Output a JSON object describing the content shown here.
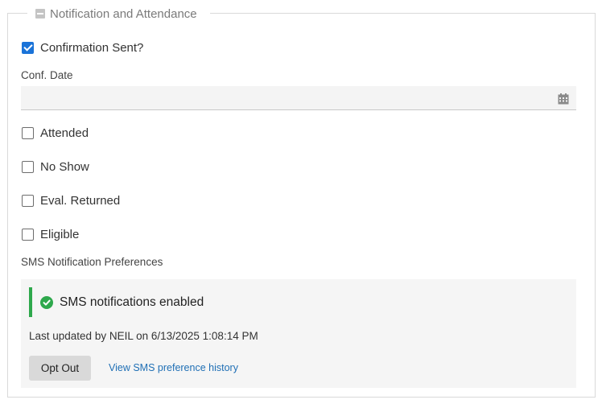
{
  "section": {
    "title": "Notification and Attendance"
  },
  "fields": {
    "confirmation_sent": {
      "label": "Confirmation Sent?",
      "checked": true
    },
    "conf_date": {
      "label": "Conf. Date",
      "value": "",
      "placeholder": ""
    },
    "attended": {
      "label": "Attended",
      "checked": false
    },
    "no_show": {
      "label": "No Show",
      "checked": false
    },
    "eval_returned": {
      "label": "Eval. Returned",
      "checked": false
    },
    "eligible": {
      "label": "Eligible",
      "checked": false
    }
  },
  "sms": {
    "section_label": "SMS Notification Preferences",
    "status": "SMS notifications enabled",
    "last_updated": "Last updated by NEIL on 6/13/2025 1:08:14 PM",
    "opt_out_label": "Opt Out",
    "history_link": "View SMS preference history"
  },
  "colors": {
    "checkbox_checked": "#1a73d8",
    "status_accent": "#2ea84c",
    "link": "#1f6fb5"
  },
  "icons": {
    "collapse": "minus-square-icon",
    "calendar": "calendar-icon",
    "status": "check-circle-icon"
  }
}
